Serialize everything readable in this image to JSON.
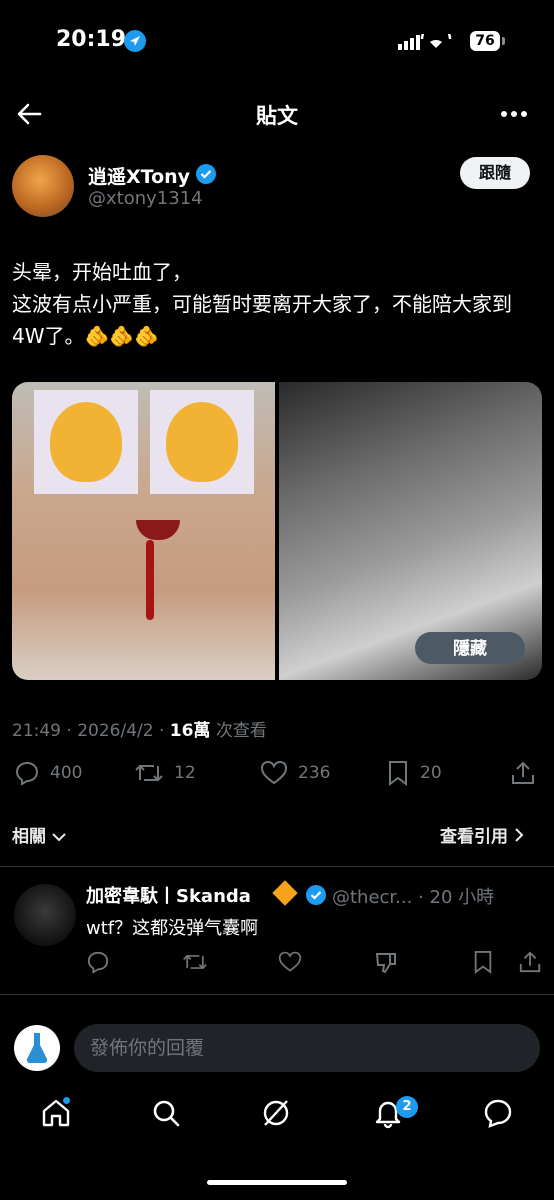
{
  "status_bar": {
    "time": "20:19",
    "battery": "76"
  },
  "header": {
    "title": "貼文"
  },
  "author": {
    "name": "逍遥XTony",
    "handle": "@xtony1314",
    "follow_label": "跟隨"
  },
  "post": {
    "text": "头晕，开始吐血了，\n这波有点小严重，可能暂时要离开大家了，不能陪大家到4W了。🫵🫵🫵",
    "hide_label": "隱藏",
    "timestamp": "21:49 · 2026/4/2 · ",
    "views_count": "16萬",
    "views_suffix": " 次查看"
  },
  "stats": {
    "replies": "400",
    "retweets": "12",
    "likes": "236",
    "bookmarks": "20"
  },
  "tabs": {
    "related": "相關",
    "view_quotes": "查看引用"
  },
  "reply": {
    "name": "加密韋馱丨Skanda",
    "handle": "@thecr... · 20 小時",
    "text": "wtf？这都没弹气囊啊"
  },
  "composer": {
    "placeholder": "發佈你的回覆"
  },
  "nav": {
    "notifications_badge": "2"
  },
  "colors": {
    "accent": "#1d9bf0",
    "background": "#000000",
    "muted": "#71767b"
  }
}
